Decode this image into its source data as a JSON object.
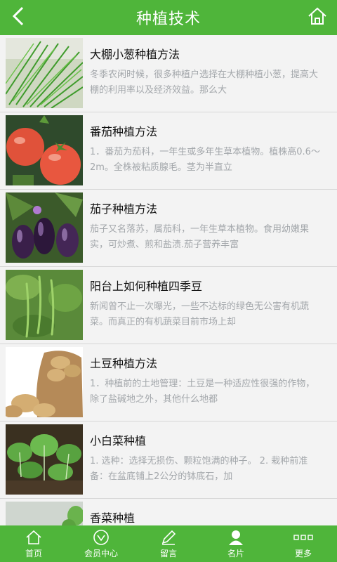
{
  "header": {
    "title": "种植技术",
    "back_icon": "back-arrow-icon",
    "home_icon": "home-icon"
  },
  "articles": [
    {
      "title": "大棚小葱种植方法",
      "summary": "冬季农闲时候，很多种植户选择在大棚种植小葱，提高大棚的利用率以及经济效益。那么大",
      "image": "green-onion-photo"
    },
    {
      "title": "番茄种植方法",
      "summary": "1．番茄为茄科，一年生或多年生草本植物。植株高0.6～2m。全株被粘质腺毛。茎为半直立",
      "image": "tomato-photo"
    },
    {
      "title": "茄子种植方法",
      "summary": "茄子又名落苏，属茄科，一年生草本植物。食用幼嫩果实，可炒煮、煎和盐渍.茄子营养丰富",
      "image": "eggplant-photo"
    },
    {
      "title": "阳台上如何种植四季豆",
      "summary": "新闻曾不止一次曝光，一些不达标的绿色无公害有机蔬菜。而真正的有机蔬菜目前市场上却",
      "image": "green-bean-photo"
    },
    {
      "title": "土豆种植方法",
      "summary": "1．种植前的土地管理：土豆是一种适应性很强的作物，除了盐碱地之外，其他什么地都",
      "image": "potato-photo"
    },
    {
      "title": "小白菜种植",
      "summary": "1. 选种：选择无损伤、颗粒饱满的种子。 2. 栽种前准备：在盆底铺上2公分的钵底石，加",
      "image": "bok-choy-photo"
    },
    {
      "title": "香菜种植",
      "summary": "",
      "image": "coriander-photo"
    }
  ],
  "tabbar": {
    "items": [
      {
        "label": "首页",
        "icon": "home-icon"
      },
      {
        "label": "会员中心",
        "icon": "member-icon"
      },
      {
        "label": "留言",
        "icon": "pencil-icon"
      },
      {
        "label": "名片",
        "icon": "person-icon"
      },
      {
        "label": "更多",
        "icon": "more-icon"
      }
    ]
  },
  "colors": {
    "brand_green": "#4fb53a",
    "title_text": "#111111",
    "summary_text": "#a3a7ab",
    "list_background": "#f3f3f3"
  }
}
